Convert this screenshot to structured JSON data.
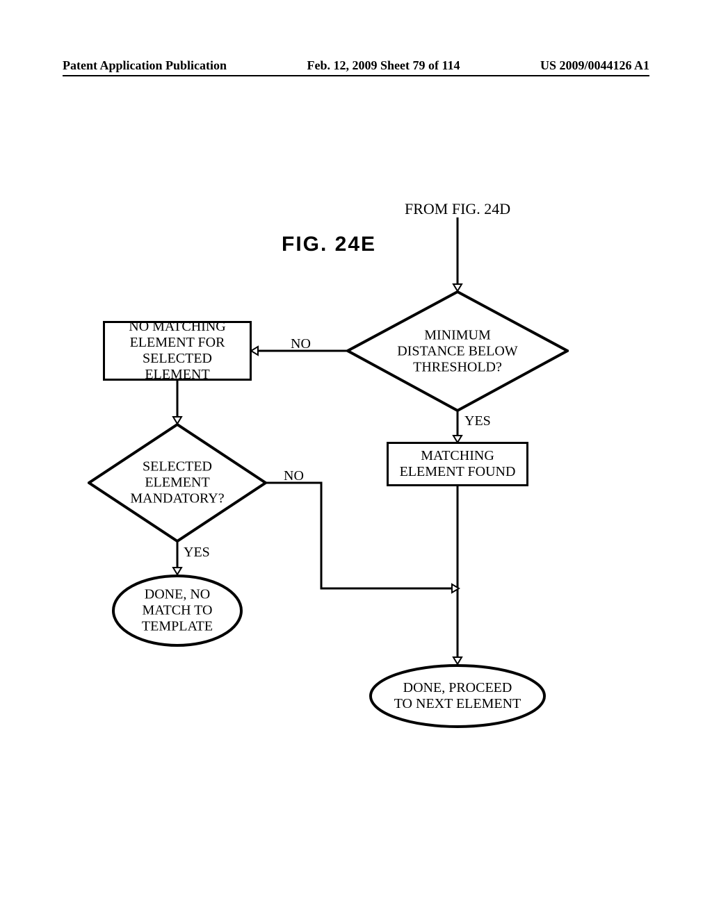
{
  "header": {
    "left": "Patent Application Publication",
    "center": "Feb. 12, 2009  Sheet 79 of 114",
    "right": "US 2009/0044126 A1"
  },
  "figure": {
    "title": "FIG.  24E",
    "from_label": "FROM FIG. 24D"
  },
  "nodes": {
    "diamond_threshold": "MINIMUM\nDISTANCE BELOW\nTHRESHOLD?",
    "box_nomatch": "NO MATCHING\nELEMENT FOR\nSELECTED ELEMENT",
    "box_found": "MATCHING\nELEMENT FOUND",
    "diamond_mandatory": "SELECTED\nELEMENT\nMANDATORY?",
    "term_done_nomatch": "DONE, NO\nMATCH TO\nTEMPLATE",
    "term_done_next": "DONE, PROCEED\nTO NEXT ELEMENT"
  },
  "edge_labels": {
    "no1": "NO",
    "yes1": "YES",
    "no2": "NO",
    "yes2": "YES"
  }
}
